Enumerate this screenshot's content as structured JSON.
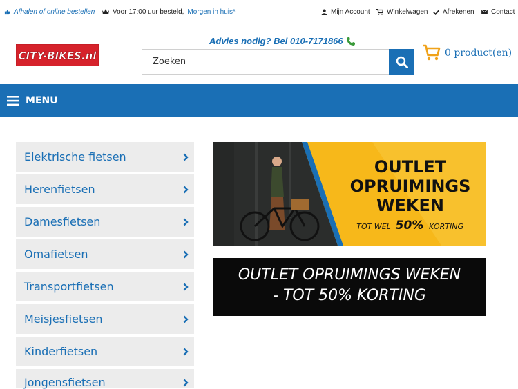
{
  "topbar": {
    "pickup": "Afhalen of online bestellen",
    "before_time": "Voor 17:00 uur besteld,",
    "tomorrow": "Morgen in huis*",
    "account": "Mijn Account",
    "cart": "Winkelwagen",
    "checkout": "Afrekenen",
    "contact": "Contact"
  },
  "logo": {
    "text": "CITY-BIKES.nl"
  },
  "advice": {
    "text": "Advies nodig? Bel 010-7171866"
  },
  "search": {
    "placeholder": "Zoeken"
  },
  "cart": {
    "label": "0 product(en)"
  },
  "nav": {
    "menu_label": "MENU"
  },
  "categories": [
    {
      "label": "Elektrische fietsen"
    },
    {
      "label": "Herenfietsen"
    },
    {
      "label": "Damesfietsen"
    },
    {
      "label": "Omafietsen"
    },
    {
      "label": "Transportfietsen"
    },
    {
      "label": "Meisjesfietsen"
    },
    {
      "label": "Kinderfietsen"
    },
    {
      "label": "Jongensfietsen"
    }
  ],
  "banner": {
    "line1": "OUTLET",
    "line2": "OPRUIMINGS",
    "line3": "WEKEN",
    "small_prefix": "TOT WEL",
    "percent": "50%",
    "small_suffix": "KORTING"
  },
  "banner_text": {
    "line1": "OUTLET OPRUIMINGS WEKEN",
    "line2": "- TOT 50% KORTING"
  },
  "colors": {
    "brand_blue": "#1a6fb5",
    "logo_red": "#d6222b",
    "banner_yellow": "#f7b81a"
  }
}
